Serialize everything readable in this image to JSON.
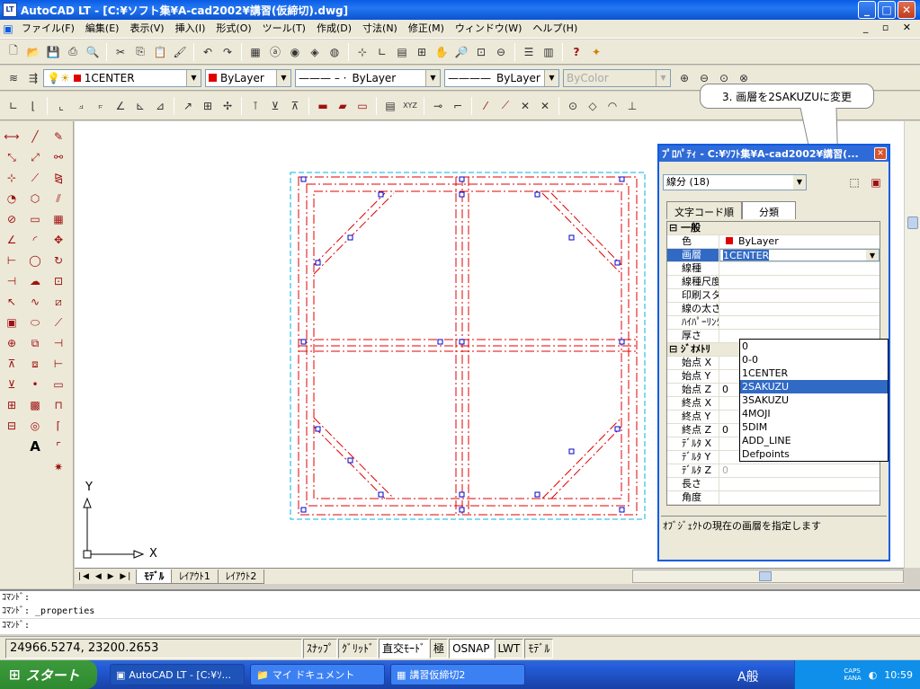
{
  "window": {
    "title": "AutoCAD LT - [C:¥ソフト集¥A-cad2002¥講習(仮締切).dwg]",
    "app_icon": "LT"
  },
  "menus": [
    "ファイル(F)",
    "編集(E)",
    "表示(V)",
    "挿入(I)",
    "形式(O)",
    "ツール(T)",
    "作成(D)",
    "寸法(N)",
    "修正(M)",
    "ウィンドウ(W)",
    "ヘルプ(H)"
  ],
  "layer_toolbar": {
    "layer_value": "1CENTER",
    "color_value": "ByLayer",
    "linetype_value": "ByLayer",
    "lineweight_value": "ByLayer",
    "plotstyle_value": "ByColor"
  },
  "callout": {
    "text": "3. 画層を2SAKUZUに変更"
  },
  "properties_palette": {
    "title": "ﾌﾟﾛﾊﾟﾃｨ - C:¥ｿﾌﾄ集¥A-cad2002¥講習(...",
    "selection": "線分 (18)",
    "tab_alpha": "文字コード順",
    "tab_categorized": "分類",
    "category_general": "一般",
    "category_geometry": "ｼﾞｵﾒﾄﾘ",
    "rows_general": [
      {
        "key": "色",
        "value": "ByLayer"
      },
      {
        "key": "画層",
        "value": "1CENTER"
      },
      {
        "key": "線種",
        "value": ""
      },
      {
        "key": "線種尺度",
        "value": ""
      },
      {
        "key": "印刷スタイル",
        "value": ""
      },
      {
        "key": "線の太さ",
        "value": ""
      },
      {
        "key": "ﾊｲﾊﾟｰﾘﾝｸ",
        "value": ""
      },
      {
        "key": "厚さ",
        "value": ""
      }
    ],
    "rows_geometry": [
      {
        "key": "始点 X",
        "value": ""
      },
      {
        "key": "始点 Y",
        "value": ""
      },
      {
        "key": "始点 Z",
        "value": "0"
      },
      {
        "key": "終点 X",
        "value": ""
      },
      {
        "key": "終点 Y",
        "value": ""
      },
      {
        "key": "終点 Z",
        "value": "0"
      },
      {
        "key": "ﾃﾞﾙﾀ X",
        "value": ""
      },
      {
        "key": "ﾃﾞﾙﾀ Y",
        "value": ""
      },
      {
        "key": "ﾃﾞﾙﾀ Z",
        "value": "0"
      },
      {
        "key": "長さ",
        "value": ""
      },
      {
        "key": "角度",
        "value": ""
      }
    ],
    "layer_options": [
      "0",
      "0-0",
      "1CENTER",
      "2SAKUZU",
      "3SAKUZU",
      "4MOJI",
      "5DIM",
      "ADD_LINE",
      "Defpoints"
    ],
    "selected_option": "2SAKUZU",
    "description": "ｵﾌﾞｼﾞｪｸﾄの現在の画層を指定します"
  },
  "tabs": {
    "model": "ﾓﾃﾞﾙ",
    "layout1": "ﾚｲｱｳﾄ1",
    "layout2": "ﾚｲｱｳﾄ2"
  },
  "ucs": {
    "x": "X",
    "y": "Y"
  },
  "command": {
    "line1": "ｺﾏﾝﾄﾞ:",
    "line2": "ｺﾏﾝﾄﾞ: _properties",
    "line3": "ｺﾏﾝﾄﾞ:"
  },
  "status": {
    "coords": "24966.5274, 23200.2653",
    "snap": "ｽﾅｯﾌﾟ",
    "grid": "ｸﾞﾘｯﾄﾞ",
    "ortho": "直交ﾓｰﾄﾞ",
    "polar": "極",
    "osnap": "OSNAP",
    "lwt": "LWT",
    "model": "ﾓﾃﾞﾙ"
  },
  "taskbar": {
    "start": "スタート",
    "tasks": [
      "AutoCAD LT - [C:¥ｿ...",
      "マイ ドキュメント",
      "講習仮締切2"
    ],
    "ime": "A般",
    "caps": "CAPS",
    "kana": "KANA",
    "clock": "10:59"
  },
  "colors": {
    "drawing_red": "#e00000",
    "drawing_blue": "#0000cc",
    "cloud_cyan": "#00b4e0",
    "title_blue": "#0a5ce4"
  }
}
